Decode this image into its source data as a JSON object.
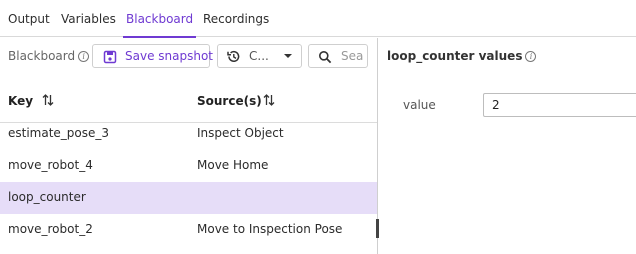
{
  "tabs": [
    {
      "label": "Output",
      "active": false
    },
    {
      "label": "Variables",
      "active": false
    },
    {
      "label": "Blackboard",
      "active": true
    },
    {
      "label": "Recordings",
      "active": false
    }
  ],
  "toolbar": {
    "label": "Blackboard",
    "save_label": "Save snapshot",
    "history_label": "C...",
    "search_placeholder": "Sea"
  },
  "table": {
    "columns": [
      "Key",
      "Source(s)"
    ],
    "rows": [
      {
        "key": "estimate_pose_3",
        "source": "Inspect Object"
      },
      {
        "key": "move_robot_4",
        "source": "Move Home"
      },
      {
        "key": "loop_counter",
        "source": "",
        "selected": true
      },
      {
        "key": "move_robot_2",
        "source": "Move to Inspection Pose"
      }
    ]
  },
  "detail": {
    "title": "loop_counter values",
    "field_label": "value",
    "field_value": "2"
  },
  "colors": {
    "accent": "#6f3ad2",
    "selected_row": "#e6ddf8"
  }
}
